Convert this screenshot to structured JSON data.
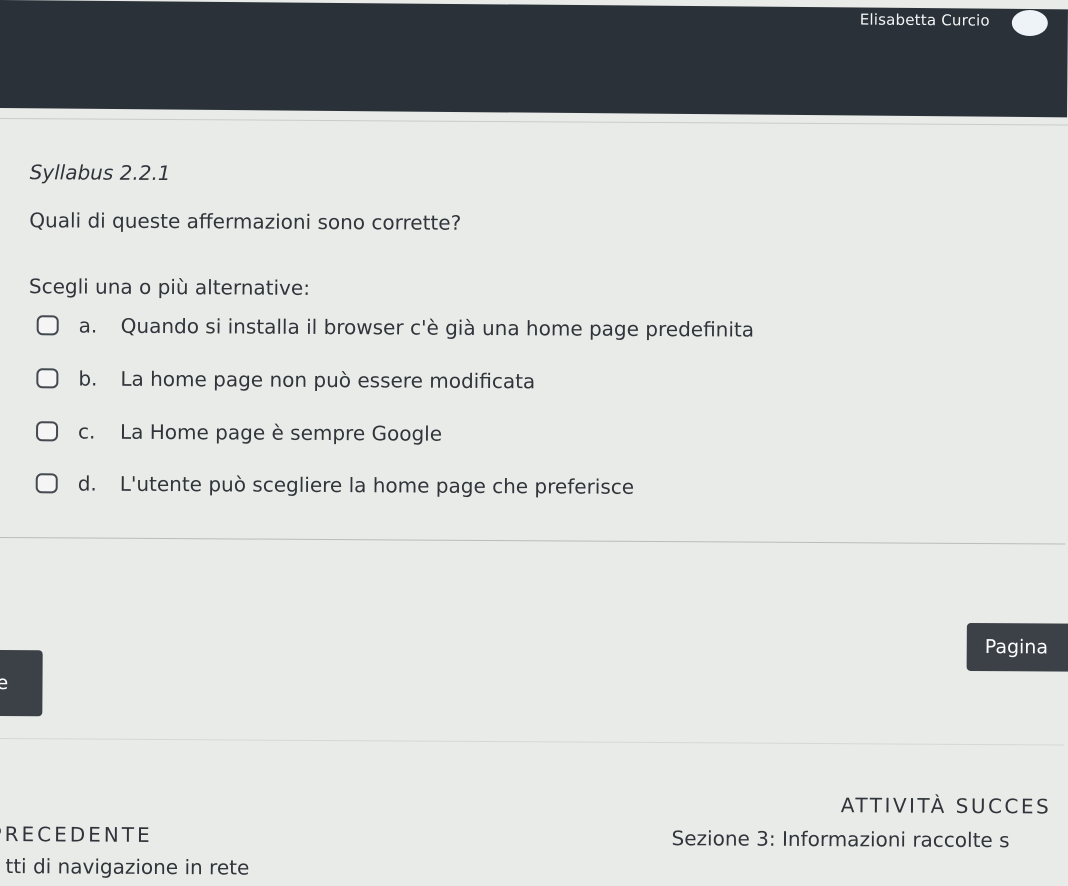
{
  "header": {
    "user_name": "Elisabetta Curcio"
  },
  "quiz": {
    "syllabus": "Syllabus 2.2.1",
    "question": "Quali di queste affermazioni sono corrette?",
    "prompt": "Scegli una o più alternative:",
    "options": [
      {
        "letter": "a.",
        "text": "Quando si installa il browser c'è già una home page predefinita",
        "checked": false
      },
      {
        "letter": "b.",
        "text": "La home page non può essere modificata",
        "checked": false
      },
      {
        "letter": "c.",
        "text": "La Home page è sempre Google",
        "checked": false
      },
      {
        "letter": "d.",
        "text": "L'utente può scegliere la home page che preferisce",
        "checked": false
      }
    ]
  },
  "navigation": {
    "page_button": "Pagina",
    "left_button": "e",
    "next_label": "ATTIVITÀ SUCCES",
    "prev_label": "PRECEDENTE",
    "next_link": "Sezione 3: Informazioni raccolte s",
    "prev_link": "tti di navigazione in rete"
  },
  "colors": {
    "topbar": "#2a3138",
    "background": "#e9ebe8",
    "button": "#3b4147",
    "text": "#30353b"
  }
}
